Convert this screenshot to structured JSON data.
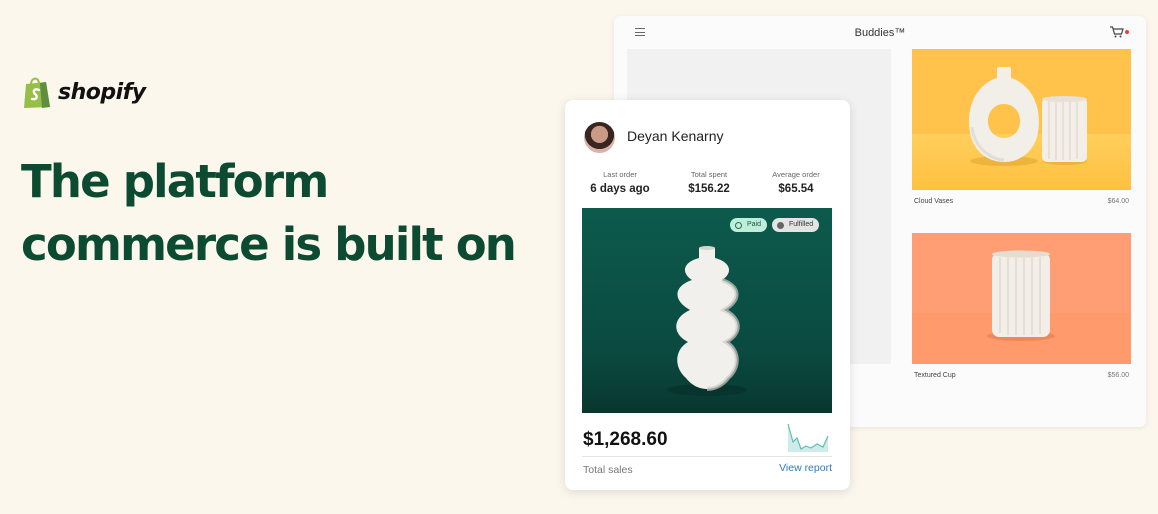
{
  "brand": {
    "logo_text": "shopify",
    "accent_green": "#0c4a32",
    "logo_green": "#95bf47"
  },
  "hero": {
    "headline_line1": "The platform",
    "headline_line2": "commerce is built on"
  },
  "store": {
    "title": "Buddies™",
    "icons": [
      "menu-icon",
      "cart-icon"
    ],
    "products": [
      {
        "name": "Cloud Vases",
        "price": "$64.00",
        "bg": "#ffc24b"
      },
      {
        "name": "Textured Cup",
        "price": "$56.00",
        "bg": "#ff9e74"
      }
    ]
  },
  "customer": {
    "name": "Deyan Kenarny",
    "stats": [
      {
        "label": "Last order",
        "value": "6 days ago"
      },
      {
        "label": "Total spent",
        "value": "$156.22"
      },
      {
        "label": "Average order",
        "value": "$65.54"
      }
    ],
    "badges": {
      "paid": "Paid",
      "fulfilled": "Fulfilled"
    },
    "total_sales_value": "$1,268.60",
    "total_sales_label": "Total sales",
    "view_report": "View report"
  }
}
